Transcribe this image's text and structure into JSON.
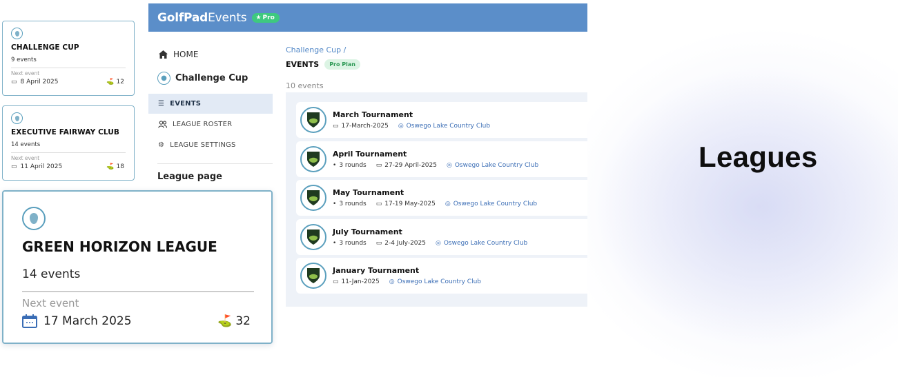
{
  "app": {
    "brand_bold": "GolfPad",
    "brand_rest": "Events",
    "pro_badge": "Pro"
  },
  "sidebar": {
    "home": "HOME",
    "league_name": "Challenge Cup",
    "items": [
      {
        "label": "EVENTS",
        "icon": "list-icon",
        "active": true
      },
      {
        "label": "LEAGUE ROSTER",
        "icon": "users-icon",
        "active": false
      },
      {
        "label": "LEAGUE SETTINGS",
        "icon": "gear-icon",
        "active": false
      }
    ],
    "league_page": "League page"
  },
  "main": {
    "breadcrumb": "Challenge Cup /",
    "title": "EVENTS",
    "plan": "Pro Plan",
    "count": "10 events",
    "events": [
      {
        "name": "March Tournament",
        "rounds": "",
        "date": "17-March-2025",
        "location": "Oswego Lake Country Club"
      },
      {
        "name": "April Tournament",
        "rounds": "3 rounds",
        "date": "27-29 April-2025",
        "location": "Oswego Lake Country Club"
      },
      {
        "name": "May Tournament",
        "rounds": "3 rounds",
        "date": "17-19 May-2025",
        "location": "Oswego Lake Country Club"
      },
      {
        "name": "July Tournament",
        "rounds": "3 rounds",
        "date": "2-4 July-2025",
        "location": "Oswego Lake Country Club"
      },
      {
        "name": "January Tournament",
        "rounds": "",
        "date": "11-Jan-2025",
        "location": "Oswego Lake Country Club"
      }
    ]
  },
  "cards": [
    {
      "name": "CHALLENGE CUP",
      "events": "9 events",
      "next_label": "Next event",
      "next_date": "8 April 2025",
      "players": "12"
    },
    {
      "name": "EXECUTIVE FAIRWAY CLUB",
      "events": "14 events",
      "next_label": "Next event",
      "next_date": "11 April 2025",
      "players": "18"
    },
    {
      "name": "GREEN HORIZON LEAGUE",
      "events": "14 events",
      "next_label": "Next event",
      "next_date": "17 March 2025",
      "players": "32"
    }
  ],
  "headline": "Leagues",
  "colors": {
    "topbar": "#5b8ec9",
    "pro": "#3ec97f",
    "accent": "#5a9fbd",
    "link": "#3a6db5"
  }
}
